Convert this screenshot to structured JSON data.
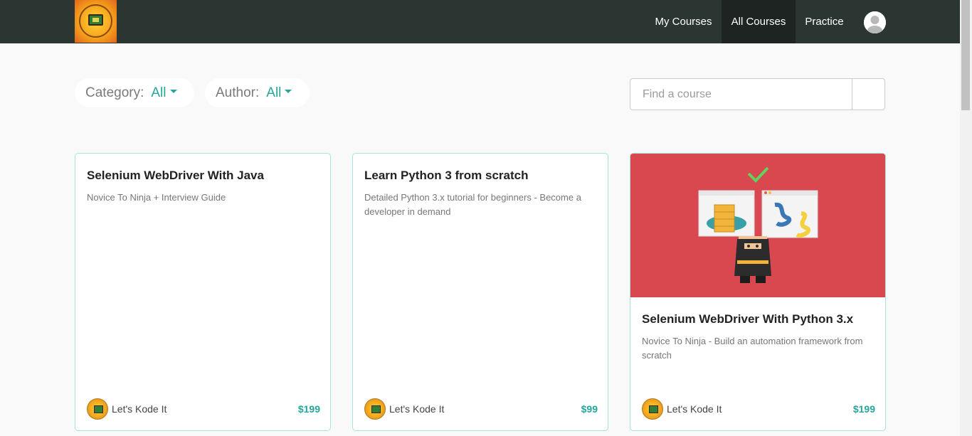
{
  "nav": {
    "items": [
      {
        "label": "My Courses"
      },
      {
        "label": "All Courses"
      },
      {
        "label": "Practice"
      }
    ]
  },
  "filters": {
    "category": {
      "label": "Category:",
      "value": "All"
    },
    "author": {
      "label": "Author:",
      "value": "All"
    }
  },
  "search": {
    "placeholder": "Find a course"
  },
  "courses": [
    {
      "title": "Selenium WebDriver With Java",
      "subtitle": "Novice To Ninja + Interview Guide",
      "author": "Let's Kode It",
      "price": "$199"
    },
    {
      "title": "Learn Python 3 from scratch",
      "subtitle": "Detailed Python 3.x tutorial for beginners - Become a developer in demand",
      "author": "Let's Kode It",
      "price": "$99"
    },
    {
      "title": "Selenium WebDriver With Python 3.x",
      "subtitle": "Novice To Ninja - Build an automation framework from scratch",
      "author": "Let's Kode It",
      "price": "$199"
    }
  ],
  "colors": {
    "navbar": "#2b3532",
    "active_nav": "#1d2422",
    "accent": "#26a69a",
    "card_border": "#a5e3dc",
    "course_image_bg": "#d9474f"
  }
}
